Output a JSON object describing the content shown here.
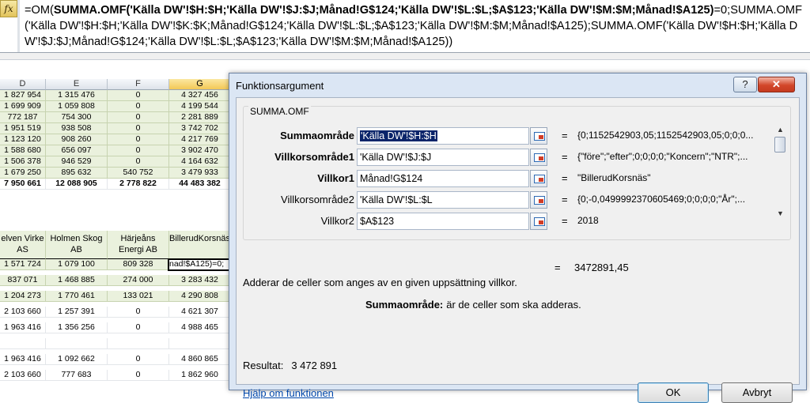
{
  "formula_bar": {
    "fx_label": "fx",
    "formula_segments": [
      {
        "text": "=OM(",
        "bold": false
      },
      {
        "text": "SUMMA.OMF('Källa DW'!$H:$H;'Källa DW'!$J:$J;Månad!G$124;'Källa DW'!$L:$L;$A$123;'Källa DW'!$M:$M;Månad!$A125)",
        "bold": true
      },
      {
        "text": "=0;SUMMA.OMF('Källa DW'!$H:$H;'Källa DW'!$K:$K;Månad!G$124;'Källa DW'!$L:$L;$A$123;'Källa DW'!$M:$M;Månad!$A125);SUMMA.OMF('Källa DW'!$H:$H;'Källa DW'!$J:$J;Månad!G$124;'Källa DW'!$L:$L;$A$123;'Källa DW'!$M:$M;Månad!$A125))",
        "bold": false
      }
    ]
  },
  "sheet": {
    "columns": [
      "D",
      "E",
      "F",
      "G"
    ],
    "selected_column": "G",
    "upper_rows": [
      [
        "1 827 954",
        "1 315 476",
        "0",
        "4 327 456"
      ],
      [
        "1 699 909",
        "1 059 808",
        "0",
        "4 199 544"
      ],
      [
        "772 187",
        "754 300",
        "0",
        "2 281 889"
      ],
      [
        "1 951 519",
        "938 508",
        "0",
        "3 742 702"
      ],
      [
        "1 123 120",
        "908 260",
        "0",
        "4 217 769"
      ],
      [
        "1 588 680",
        "656 097",
        "0",
        "3 902 470"
      ],
      [
        "1 506 378",
        "946 529",
        "0",
        "4 164 632"
      ],
      [
        "1 679 250",
        "895 632",
        "540 752",
        "3 479 933"
      ]
    ],
    "total_row": [
      "7 950 661",
      "12 088 905",
      "2 778 822",
      "44 483 382"
    ],
    "lower_headers": [
      "elven Virke AS",
      "Holmen Skog AB",
      "Härjeåns Energi AB",
      "BillerudKorsnäs"
    ],
    "active_cell_text": "nad!$A125)=0;",
    "lower_rows": [
      [
        "1 571 724",
        "1 079 100",
        "809 328",
        ""
      ],
      [
        "837 071",
        "1 468 885",
        "274 000",
        "3 283 432"
      ],
      [
        "1 204 273",
        "1 770 461",
        "133 021",
        "4 290 808"
      ],
      [
        "2 103 660",
        "1 257 391",
        "0",
        "4 621 307"
      ],
      [
        "1 963 416",
        "1 356 256",
        "0",
        "4 988 465"
      ],
      [
        "",
        "",
        "",
        ""
      ],
      [
        "1 963 416",
        "1 092 662",
        "0",
        "4 860 865"
      ],
      [
        "2 103 660",
        "777 683",
        "0",
        "1 862 960"
      ]
    ]
  },
  "dialog": {
    "title": "Funktionsargument",
    "help_btn": "?",
    "close_btn": "✕",
    "function_name": "SUMMA.OMF",
    "args": [
      {
        "label": "Summaområde",
        "bold": true,
        "value": "'Källa DW'!$H:$H",
        "highlighted": true,
        "result": "{0;1152542903,05;1152542903,05;0;0;0..."
      },
      {
        "label": "Villkorsområde1",
        "bold": true,
        "value": "'Källa DW'!$J:$J",
        "highlighted": false,
        "result": "{\"före\";\"efter\";0;0;0;0;\"Koncern\";\"NTR\";..."
      },
      {
        "label": "Villkor1",
        "bold": true,
        "value": "Månad!G$124",
        "highlighted": false,
        "result": "\"BillerudKorsnäs\""
      },
      {
        "label": "Villkorsområde2",
        "bold": false,
        "value": "'Källa DW'!$L:$L",
        "highlighted": false,
        "result": "{0;-0,0499992370605469;0;0;0;0;\"År\";..."
      },
      {
        "label": "Villkor2",
        "bold": false,
        "value": "$A$123",
        "highlighted": false,
        "result": "2018"
      }
    ],
    "equals": "=",
    "formula_result": "3472891,45",
    "description": "Adderar de celler som anges av en given uppsättning villkor.",
    "arg_desc_label": "Summaområde:",
    "arg_desc_text": "är de celler som ska adderas.",
    "result_label": "Resultat:",
    "result_value": "3 472 891",
    "help_link": "Hjälp om funktionen",
    "ok_label": "OK",
    "cancel_label": "Avbryt"
  }
}
